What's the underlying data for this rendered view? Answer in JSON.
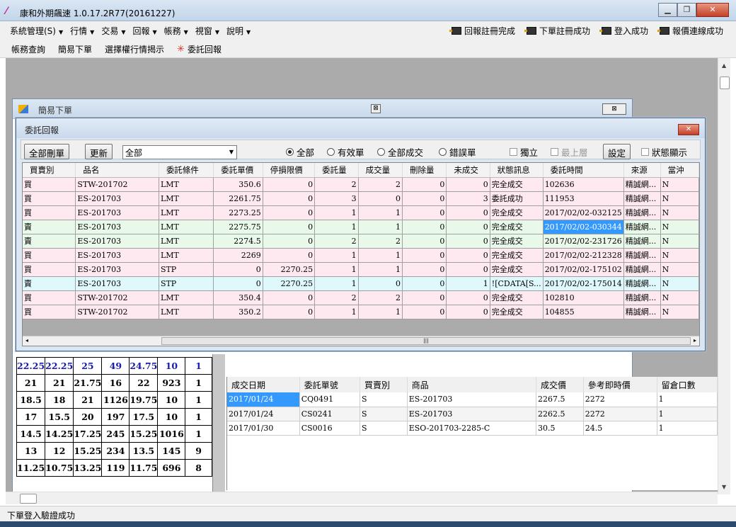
{
  "window": {
    "title": "康和外期飆速 1.0.17.2R77(20161227)"
  },
  "menu": [
    "系統管理(S)",
    "行情",
    "交易",
    "回報",
    "帳務",
    "視窗",
    "說明"
  ],
  "status_indicators": [
    "回報註冊完成",
    "下單註冊成功",
    "登入成功",
    "報價連線成功"
  ],
  "toolbar": [
    "帳務查詢",
    "簡易下單",
    "選擇權行情揭示",
    "委託回報"
  ],
  "back_window": {
    "title": "簡易下單"
  },
  "dialog": {
    "title": "委託回報",
    "buttons": {
      "delete_all": "全部刪單",
      "refresh": "更新",
      "settings": "設定"
    },
    "filter_select": "全部",
    "radios": [
      "全部",
      "有效單",
      "全部成交",
      "錯誤單"
    ],
    "checks": {
      "standalone": "獨立",
      "topmost": "最上層",
      "status_display": "狀態顯示"
    },
    "columns": [
      "買賣別",
      "品名",
      "委託條件",
      "委託單價",
      "停損限價",
      "委託量",
      "成交量",
      "刪除量",
      "未成交",
      "狀態訊息",
      "委託時間",
      "來源",
      "當沖"
    ],
    "rows": [
      {
        "side": "買",
        "product": "STW-201702",
        "cond": "LMT",
        "price": "350.6",
        "stop": "0",
        "qty": "2",
        "filled": "2",
        "deleted": "0",
        "open": "0",
        "status": "完全成交",
        "time": "102636",
        "source": "精誠網...",
        "daytrade": "N",
        "type": "buy"
      },
      {
        "side": "買",
        "product": "ES-201703",
        "cond": "LMT",
        "price": "2261.75",
        "stop": "0",
        "qty": "3",
        "filled": "0",
        "deleted": "0",
        "open": "3",
        "status": "委託成功",
        "time": "111953",
        "source": "精誠網...",
        "daytrade": "N",
        "type": "buy"
      },
      {
        "side": "買",
        "product": "ES-201703",
        "cond": "LMT",
        "price": "2273.25",
        "stop": "0",
        "qty": "1",
        "filled": "1",
        "deleted": "0",
        "open": "0",
        "status": "完全成交",
        "time": "2017/02/02-032125",
        "source": "精誠網...",
        "daytrade": "N",
        "type": "buy"
      },
      {
        "side": "賣",
        "product": "ES-201703",
        "cond": "LMT",
        "price": "2275.75",
        "stop": "0",
        "qty": "1",
        "filled": "1",
        "deleted": "0",
        "open": "0",
        "status": "完全成交",
        "time": "2017/02/02-030344",
        "source": "精誠網...",
        "daytrade": "N",
        "type": "sell"
      },
      {
        "side": "賣",
        "product": "ES-201703",
        "cond": "LMT",
        "price": "2274.5",
        "stop": "0",
        "qty": "2",
        "filled": "2",
        "deleted": "0",
        "open": "0",
        "status": "完全成交",
        "time": "2017/02/02-231726",
        "source": "精誠網...",
        "daytrade": "N",
        "type": "sell"
      },
      {
        "side": "買",
        "product": "ES-201703",
        "cond": "LMT",
        "price": "2269",
        "stop": "0",
        "qty": "1",
        "filled": "1",
        "deleted": "0",
        "open": "0",
        "status": "完全成交",
        "time": "2017/02/02-212328",
        "source": "精誠網...",
        "daytrade": "N",
        "type": "buy"
      },
      {
        "side": "買",
        "product": "ES-201703",
        "cond": "STP",
        "price": "0",
        "stop": "2270.25",
        "qty": "1",
        "filled": "1",
        "deleted": "0",
        "open": "0",
        "status": "完全成交",
        "time": "2017/02/02-175102",
        "source": "精誠網...",
        "daytrade": "N",
        "type": "buy"
      },
      {
        "side": "賣",
        "product": "ES-201703",
        "cond": "STP",
        "price": "0",
        "stop": "2270.25",
        "qty": "1",
        "filled": "0",
        "deleted": "0",
        "open": "1",
        "status": "![CDATA[S...",
        "time": "2017/02/02-175014",
        "source": "精誠網...",
        "daytrade": "N",
        "type": "err"
      },
      {
        "side": "買",
        "product": "STW-201702",
        "cond": "LMT",
        "price": "350.4",
        "stop": "0",
        "qty": "2",
        "filled": "2",
        "deleted": "0",
        "open": "0",
        "status": "完全成交",
        "time": "102810",
        "source": "精誠網...",
        "daytrade": "N",
        "type": "buy"
      },
      {
        "side": "買",
        "product": "STW-201702",
        "cond": "LMT",
        "price": "350.2",
        "stop": "0",
        "qty": "1",
        "filled": "1",
        "deleted": "0",
        "open": "0",
        "status": "完全成交",
        "time": "104855",
        "source": "精誠網...",
        "daytrade": "N",
        "type": "buy"
      }
    ],
    "selected_time": "2017/02/02-030344"
  },
  "price_grid": [
    [
      "22.25",
      "22.25",
      "25",
      "49",
      "24.75",
      "10",
      "1"
    ],
    [
      "21",
      "21",
      "21.75",
      "16",
      "22",
      "923",
      "1"
    ],
    [
      "18.5",
      "18",
      "21",
      "1126",
      "19.75",
      "10",
      "1"
    ],
    [
      "17",
      "15.5",
      "20",
      "197",
      "17.5",
      "10",
      "1"
    ],
    [
      "14.5",
      "14.25",
      "17.25",
      "245",
      "15.25",
      "1016",
      "1"
    ],
    [
      "13",
      "12",
      "15.25",
      "234",
      "13.5",
      "145",
      "9"
    ],
    [
      "11.25",
      "10.75",
      "13.25",
      "119",
      "11.75",
      "696",
      "8"
    ]
  ],
  "trades": {
    "columns": [
      "成交日期",
      "委託單號",
      "買賣別",
      "商品",
      "成交價",
      "參考即時價",
      "留倉口數"
    ],
    "rows": [
      [
        "2017/01/24",
        "CQ0491",
        "S",
        "ES-201703",
        "2267.5",
        "2272",
        "1"
      ],
      [
        "2017/01/24",
        "CS0241",
        "S",
        "ES-201703",
        "2262.5",
        "2272",
        "1"
      ],
      [
        "2017/01/30",
        "CS0016",
        "S",
        "ESO-201703-2285-C",
        "30.5",
        "24.5",
        "1"
      ]
    ]
  },
  "statusbar": "下單登入驗證成功"
}
